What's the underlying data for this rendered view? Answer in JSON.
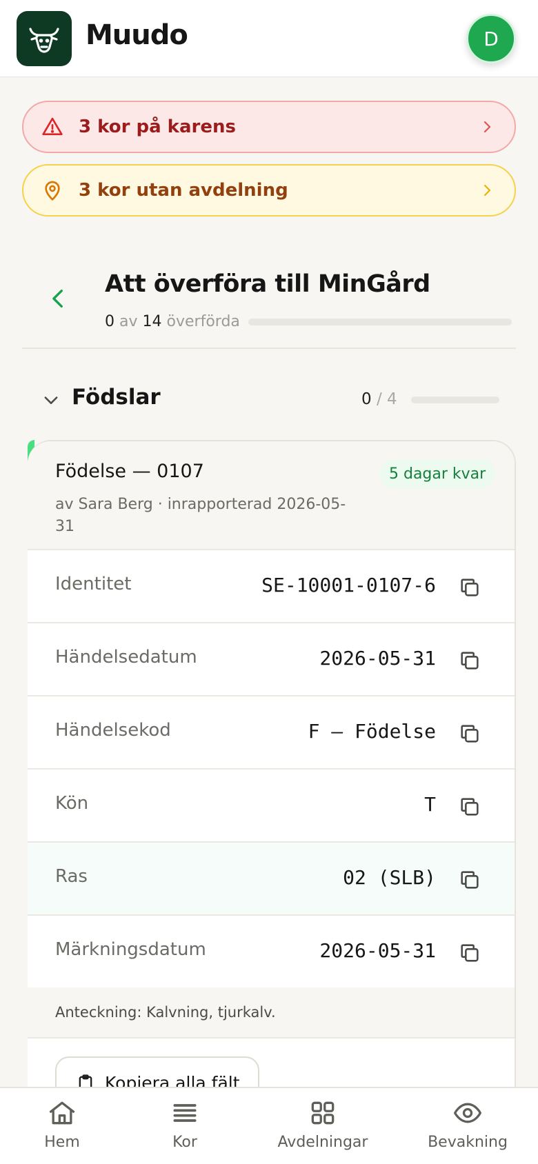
{
  "header": {
    "title": "Muudo",
    "avatar_initial": "D"
  },
  "alerts": [
    {
      "text": "3 kor på karens",
      "color": "#9b1c1c"
    },
    {
      "text": "3 kor utan avdelning",
      "color": "#92400e"
    }
  ],
  "transfer": {
    "title": "Att överföra till MinGård",
    "done": "0",
    "of_label": "av",
    "total": "14",
    "suffix": "överförda",
    "progress": 0
  },
  "section": {
    "title": "Födslar",
    "done": "0",
    "sep": "/",
    "total": "4",
    "progress": 0
  },
  "card": {
    "title": "Födelse — 0107",
    "badge": "5 dagar kvar",
    "subtitle": "av Sara Berg · inrapporterad 2026-05-31",
    "accent_color": "#4ade80",
    "fields": [
      {
        "label": "Identitet",
        "value": "SE-10001-0107-6"
      },
      {
        "label": "Händelsedatum",
        "value": "2026-05-31"
      },
      {
        "label": "Händelsekod",
        "value": "F — Födelse"
      },
      {
        "label": "Kön",
        "value": "T"
      },
      {
        "label": "Ras",
        "value": "02 (SLB)"
      },
      {
        "label": "Märkningsdatum",
        "value": "2026-05-31"
      }
    ],
    "note": "Anteckning: Kalvning, tjurkalv.",
    "copy_all_label": "Kopiera alla fält"
  },
  "tabbar": [
    {
      "label": "Hem",
      "icon": "home-icon"
    },
    {
      "label": "Kor",
      "icon": "list-icon"
    },
    {
      "label": "Avdelningar",
      "icon": "grid-icon"
    },
    {
      "label": "Bevakning",
      "icon": "eye-icon"
    }
  ]
}
